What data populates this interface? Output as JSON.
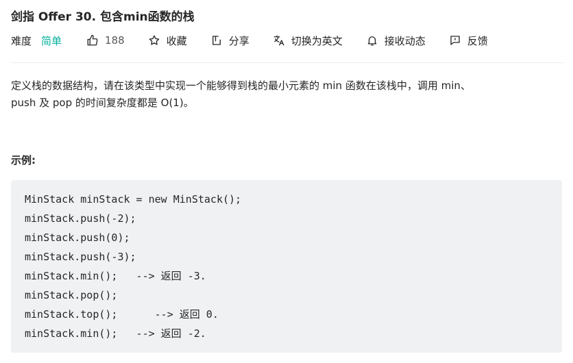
{
  "problem": {
    "title": "剑指 Offer 30. 包含min函数的栈",
    "difficulty_label": "难度",
    "difficulty_value": "简单",
    "difficulty_color": "#00af9b",
    "like_count": "188",
    "actions": {
      "favorite": "收藏",
      "share": "分享",
      "translate": "切换为英文",
      "subscribe": "接收动态",
      "feedback": "反馈"
    },
    "description_line1": "定义栈的数据结构，请在该类型中实现一个能够得到栈的最小元素的 min 函数在该栈中，调用 min、",
    "description_line2": "push 及 pop 的时间复杂度都是 O(1)。",
    "example_title": "示例:",
    "code_lines": [
      "MinStack minStack = new MinStack();",
      "minStack.push(-2);",
      "minStack.push(0);",
      "minStack.push(-3);",
      "minStack.min();   --> 返回 -3.",
      "minStack.pop();",
      "minStack.top();      --> 返回 0.",
      "minStack.min();   --> 返回 -2."
    ]
  },
  "icons": {
    "like": "thumbs-up-icon",
    "favorite": "star-icon",
    "share": "share-icon",
    "translate": "translate-icon",
    "subscribe": "bell-icon",
    "feedback": "feedback-icon"
  }
}
